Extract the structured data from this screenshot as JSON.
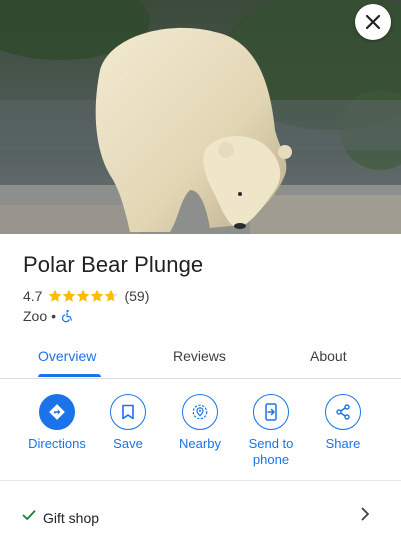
{
  "place": {
    "name": "Polar Bear Plunge",
    "rating": "4.7",
    "stars": 4.7,
    "review_count": "(59)",
    "category": "Zoo",
    "separator": "•"
  },
  "tabs": [
    {
      "label": "Overview",
      "active": true
    },
    {
      "label": "Reviews",
      "active": false
    },
    {
      "label": "About",
      "active": false
    }
  ],
  "actions": [
    {
      "label": "Directions",
      "icon": "directions-icon"
    },
    {
      "label": "Save",
      "icon": "bookmark-icon"
    },
    {
      "label": "Nearby",
      "icon": "nearby-icon"
    },
    {
      "label": "Send to phone",
      "icon": "send-to-phone-icon"
    },
    {
      "label": "Share",
      "icon": "share-icon"
    }
  ],
  "amenity": {
    "label": "Gift shop",
    "icon": "check-icon"
  },
  "colors": {
    "accent": "#1a73e8",
    "star": "#fbbc04",
    "text": "#202124",
    "check": "#188038"
  }
}
